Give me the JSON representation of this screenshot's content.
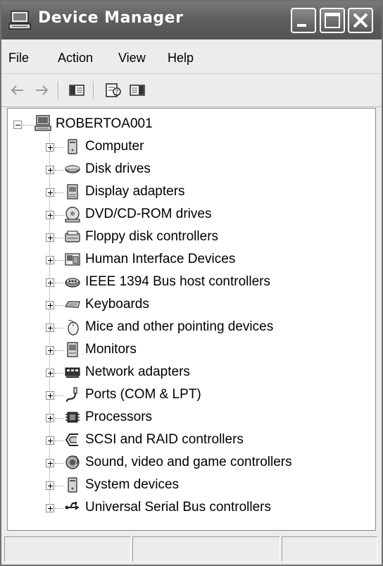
{
  "window": {
    "title": "Device Manager",
    "title_icon": "computer-monitor-icon",
    "controls": {
      "minimize_icon": "minimize-icon",
      "maximize_icon": "maximize-icon",
      "close_icon": "close-icon"
    }
  },
  "menu": {
    "items": [
      {
        "label": "File"
      },
      {
        "label": "Action"
      },
      {
        "label": "View"
      },
      {
        "label": "Help"
      }
    ]
  },
  "toolbar": {
    "buttons": [
      {
        "icon": "back-arrow-icon"
      },
      {
        "icon": "forward-arrow-icon"
      },
      {
        "icon": "show-hide-console-tree-icon"
      },
      {
        "icon": "properties-icon"
      },
      {
        "icon": "help-pane-icon"
      }
    ]
  },
  "tree": {
    "root": {
      "label": "ROBERTOA001",
      "icon": "computer-icon",
      "expanded": true
    },
    "items": [
      {
        "label": "Computer",
        "icon": "computer-tower-icon"
      },
      {
        "label": "Disk drives",
        "icon": "disk-drive-icon"
      },
      {
        "label": "Display adapters",
        "icon": "display-adapter-icon"
      },
      {
        "label": "DVD/CD-ROM drives",
        "icon": "cd-drive-icon"
      },
      {
        "label": "Floppy disk controllers",
        "icon": "floppy-controller-icon"
      },
      {
        "label": "Human Interface Devices",
        "icon": "hid-icon"
      },
      {
        "label": "IEEE 1394 Bus host controllers",
        "icon": "ieee1394-icon"
      },
      {
        "label": "Keyboards",
        "icon": "keyboard-icon"
      },
      {
        "label": "Mice and other pointing devices",
        "icon": "mouse-icon"
      },
      {
        "label": "Monitors",
        "icon": "monitor-icon"
      },
      {
        "label": "Network adapters",
        "icon": "network-adapter-icon"
      },
      {
        "label": "Ports (COM & LPT)",
        "icon": "port-icon"
      },
      {
        "label": "Processors",
        "icon": "processor-icon"
      },
      {
        "label": "SCSI and RAID controllers",
        "icon": "scsi-icon"
      },
      {
        "label": "Sound, video and game controllers",
        "icon": "sound-icon"
      },
      {
        "label": "System devices",
        "icon": "system-devices-icon"
      },
      {
        "label": "Universal Serial Bus controllers",
        "icon": "usb-icon"
      }
    ]
  },
  "statusbar": {
    "panels": [
      "",
      "",
      ""
    ]
  }
}
